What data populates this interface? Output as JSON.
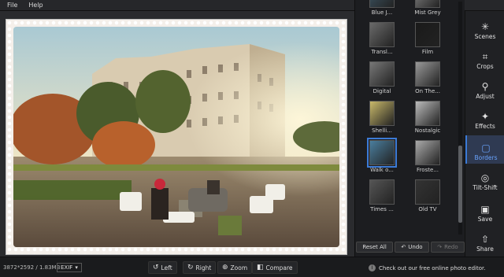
{
  "menu": {
    "file": "File",
    "help": "Help"
  },
  "filters": [
    {
      "label": "Blue J...",
      "selected": false
    },
    {
      "label": "Mist Grey",
      "selected": false
    },
    {
      "label": "Transl...",
      "selected": false
    },
    {
      "label": "Film",
      "selected": false
    },
    {
      "label": "Digital",
      "selected": false
    },
    {
      "label": "On The...",
      "selected": false
    },
    {
      "label": "Shelli...",
      "selected": false
    },
    {
      "label": "Nostalgic",
      "selected": false
    },
    {
      "label": "Walk o...",
      "selected": true
    },
    {
      "label": "Froste...",
      "selected": false
    },
    {
      "label": "Times ...",
      "selected": false
    },
    {
      "label": "Old TV",
      "selected": false
    }
  ],
  "strip_buttons": {
    "reset": "Reset All",
    "undo": "Undo",
    "redo": "Redo"
  },
  "tools": [
    {
      "label": "Scenes",
      "icon": "scenes-icon",
      "glyph": "✳"
    },
    {
      "label": "Crops",
      "icon": "crop-icon",
      "glyph": "⌗"
    },
    {
      "label": "Adjust",
      "icon": "adjust-icon",
      "glyph": "⚲"
    },
    {
      "label": "Effects",
      "icon": "effects-icon",
      "glyph": "✦"
    },
    {
      "label": "Borders",
      "icon": "borders-icon",
      "glyph": "▢"
    },
    {
      "label": "Tilt-Shift",
      "icon": "tilt-shift-icon",
      "glyph": "◎"
    },
    {
      "label": "Save",
      "icon": "save-icon",
      "glyph": "▣"
    },
    {
      "label": "Share",
      "icon": "share-icon",
      "glyph": "⇧"
    }
  ],
  "active_tool": "Borders",
  "status": {
    "dimensions": "3872*2592 / 1.83MB",
    "exif": "EXIF",
    "left": "Left",
    "right": "Right",
    "zoom": "Zoom",
    "compare": "Compare",
    "promo": "Check out our free online photo editor."
  },
  "colors": {
    "accent": "#3b7bd8",
    "background": "#202123"
  }
}
